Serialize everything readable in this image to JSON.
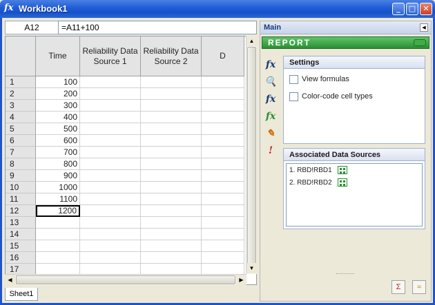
{
  "window": {
    "title": "Workbook1",
    "app_icon": "fx-icon",
    "buttons": {
      "minimize": "_",
      "maximize": "□",
      "close": "✕"
    }
  },
  "formula_bar": {
    "cell_ref": "A12",
    "formula": "=A11+100"
  },
  "grid": {
    "columns": [
      "Time",
      "Reliability Data Source 1",
      "Reliability Data Source 2",
      "D"
    ],
    "rows": [
      {
        "num": "1",
        "time": "100"
      },
      {
        "num": "2",
        "time": "200"
      },
      {
        "num": "3",
        "time": "300"
      },
      {
        "num": "4",
        "time": "400"
      },
      {
        "num": "5",
        "time": "500"
      },
      {
        "num": "6",
        "time": "600"
      },
      {
        "num": "7",
        "time": "700"
      },
      {
        "num": "8",
        "time": "800"
      },
      {
        "num": "9",
        "time": "900"
      },
      {
        "num": "10",
        "time": "1000"
      },
      {
        "num": "11",
        "time": "1100"
      },
      {
        "num": "12",
        "time": "1200"
      },
      {
        "num": "13",
        "time": ""
      },
      {
        "num": "14",
        "time": ""
      },
      {
        "num": "15",
        "time": ""
      },
      {
        "num": "16",
        "time": ""
      },
      {
        "num": "17",
        "time": ""
      }
    ],
    "selected_row": 12
  },
  "sheet_tab": "Sheet1",
  "panel": {
    "header": "Main",
    "report_label": "Report",
    "tools": [
      "insert-function-icon",
      "zoom-icon",
      "function-search-icon",
      "refresh-function-icon",
      "edit-icon",
      "error-check-icon"
    ],
    "settings": {
      "title": "Settings",
      "view_formulas": "View formulas",
      "color_code": "Color-code cell types"
    },
    "data_sources": {
      "title": "Associated Data Sources",
      "items": [
        "1. RBD!RBD1",
        "2. RBD!RBD2"
      ]
    }
  }
}
